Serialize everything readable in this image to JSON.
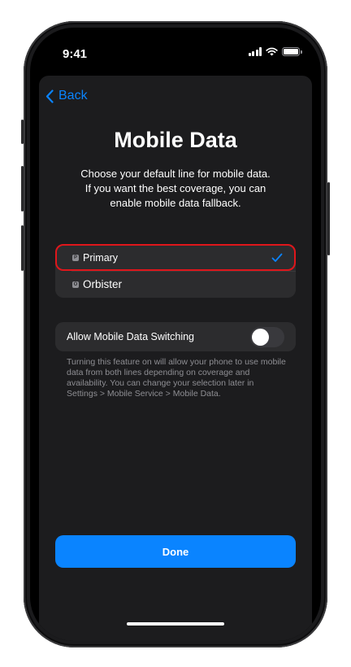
{
  "status_bar": {
    "time": "9:41",
    "icons": [
      "cellular-signal-icon",
      "wifi-icon",
      "battery-icon"
    ]
  },
  "nav": {
    "back_label": "Back",
    "back_icon": "chevron-left-icon"
  },
  "page": {
    "title": "Mobile Data",
    "description": "Choose your default line for mobile data. If you want the best coverage, you can enable mobile data fallback."
  },
  "lines": [
    {
      "badge": "P",
      "label": "Primary",
      "selected": true
    },
    {
      "badge": "O",
      "label": "Orbister",
      "selected": false
    }
  ],
  "data_switching": {
    "label": "Allow Mobile Data Switching",
    "enabled": false,
    "footnote": "Turning this feature on will allow your phone to use mobile data from both lines depending on coverage and availability. You can change your selection later in Settings > Mobile Service > Mobile Data."
  },
  "done_label": "Done",
  "colors": {
    "accent": "#0a84ff",
    "selection_outline": "#e0161b",
    "sheet_background": "#1c1c1e",
    "row_background": "#2c2c2e"
  }
}
